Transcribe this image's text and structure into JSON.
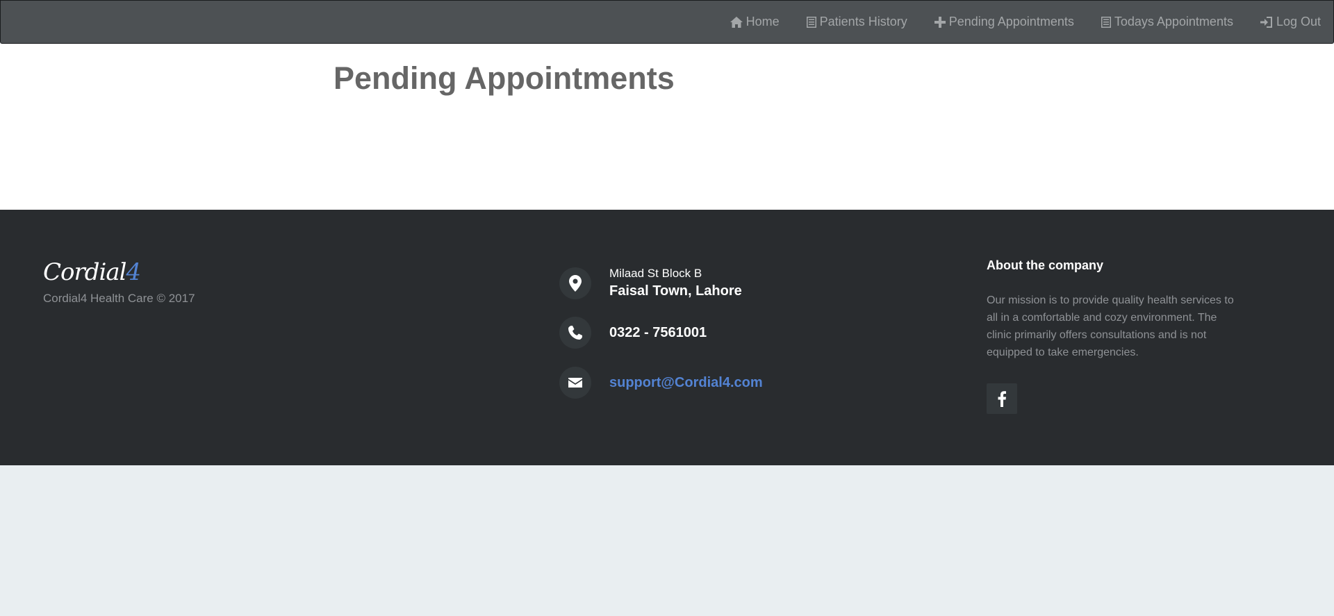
{
  "nav": {
    "items": [
      {
        "label": "Home",
        "icon": "home-icon"
      },
      {
        "label": "Patients History",
        "icon": "list-icon"
      },
      {
        "label": "Pending Appointments",
        "icon": "plus-icon"
      },
      {
        "label": "Todays Appointments",
        "icon": "list-icon"
      },
      {
        "label": "Log Out",
        "icon": "logout-icon"
      }
    ]
  },
  "main": {
    "title": "Pending Appointments"
  },
  "footer": {
    "brand_main": "Cordial",
    "brand_accent": "4",
    "copyright": "Cordial4 Health Care © 2017",
    "address_line1": "Milaad St Block B",
    "address_line2": "Faisal Town, Lahore",
    "phone": "0322 - 7561001",
    "email": "support@Cordial4.com",
    "about_title": "About the company",
    "about_text": "Our mission is to provide quality health services to all in a comfortable and cozy environment. The clinic primarily offers consultations and is not equipped to take emergencies."
  },
  "colors": {
    "navbar_bg": "#4d5154",
    "footer_bg": "#292c2f",
    "accent": "#5383d3",
    "page_bg": "#e9eef1"
  }
}
